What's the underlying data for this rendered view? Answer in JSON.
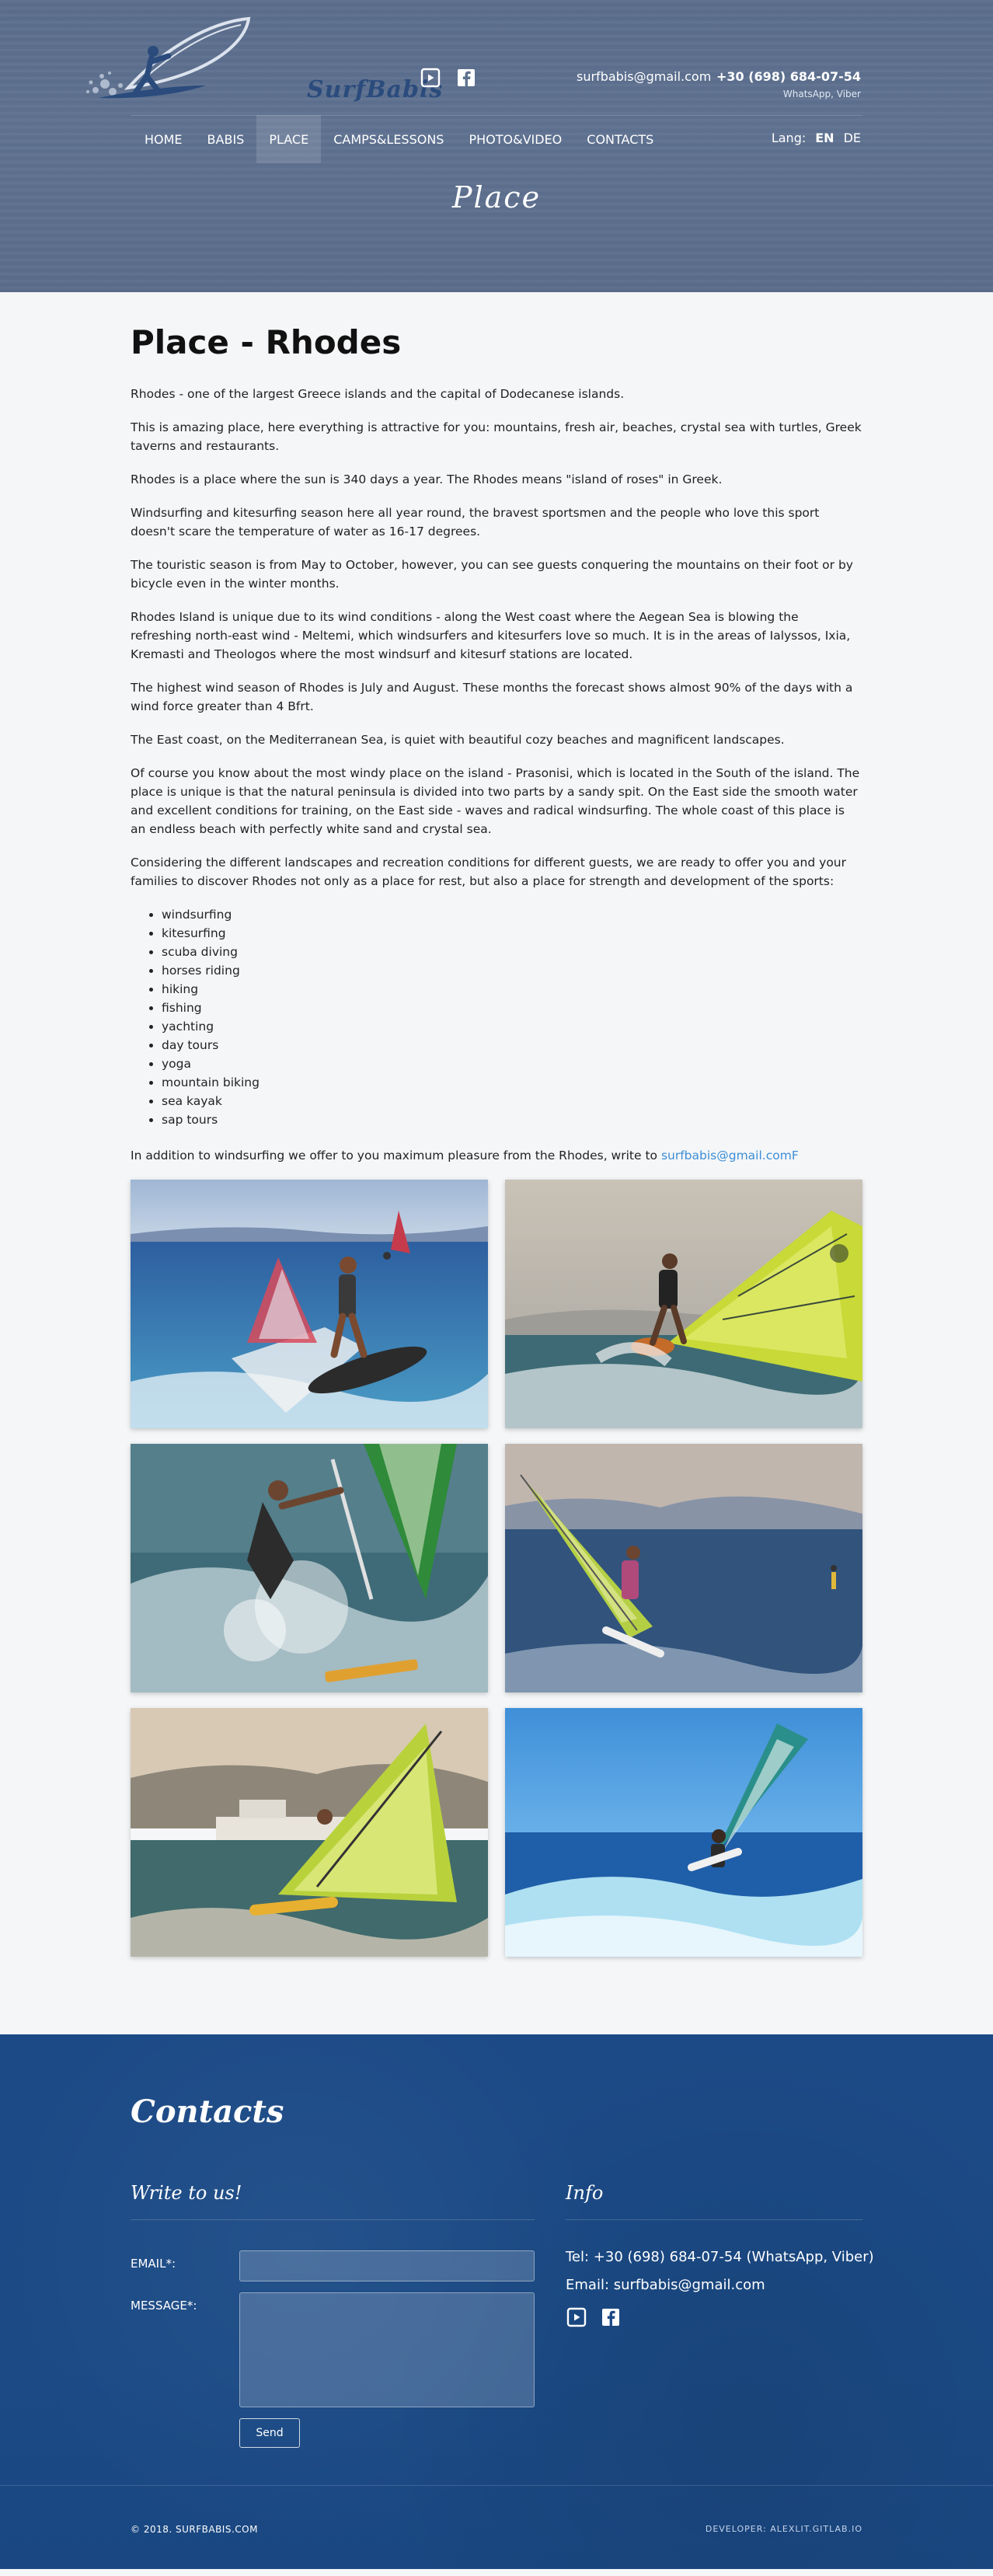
{
  "header": {
    "logo_text": "SurfBabis",
    "email": "surfbabis@gmail.com",
    "phone": "+30 (698) 684-07-54",
    "phone_note": "WhatsApp, Viber",
    "social_icons": [
      "youtube-icon",
      "facebook-icon"
    ],
    "nav": [
      {
        "label": "HOME",
        "active": false
      },
      {
        "label": "BABIS",
        "active": false
      },
      {
        "label": "PLACE",
        "active": true
      },
      {
        "label": "CAMPS&LESSONS",
        "active": false
      },
      {
        "label": "PHOTO&VIDEO",
        "active": false
      },
      {
        "label": "CONTACTS",
        "active": false
      }
    ],
    "lang_label": "Lang:",
    "lang_current": "EN",
    "lang_other": "DE",
    "hero_title": "Place"
  },
  "main": {
    "title": "Place - Rhodes",
    "paragraphs": [
      "Rhodes - one of the largest Greece islands and the capital of Dodecanese islands.",
      "This is amazing place, here everything is attractive for you: mountains, fresh air, beaches, crystal sea with turtles, Greek taverns and restaurants.",
      "Rhodes is a place where the sun is 340 days a year. The Rhodes means \"island of roses\" in Greek.",
      "Windsurfing and kitesurfing season here all year round, the bravest sportsmen and the people who love this sport doesn't scare the temperature of water as 16-17 degrees.",
      "The touristic season is from May to October, however, you can see guests conquering the mountains on their foot or by bicycle even in the winter months.",
      "Rhodes Island is unique due to its wind conditions - along the West coast where the Aegean Sea is blowing the refreshing north-east wind - Meltemi, which windsurfers and kitesurfers love so much. It is in the areas of Ialyssos, Ixia, Kremasti and Theologos where the most windsurf and kitesurf stations are located.",
      "The highest wind season of Rhodes is July and August. These months the forecast shows almost 90% of the days with a wind force greater than 4 Bfrt.",
      "The East coast, on the Mediterranean Sea, is quiet with beautiful cozy beaches and magnificent landscapes.",
      "Of course you know about the most windy place on the island - Prasonisi, which is located in the South of the island. The place is unique is that the natural peninsula is divided into two parts by a sandy spit. On the East side the smooth water and excellent conditions for training, on the East side - waves and radical windsurfing. The whole coast of this place is an endless beach with perfectly white sand and crystal sea.",
      "Considering the different landscapes and recreation conditions for different guests, we are ready to offer you and your families to discover Rhodes not only as a place for rest, but also a place for strength and development of the sports:"
    ],
    "sports": [
      "windsurfing",
      "kitesurfing",
      "scuba diving",
      "horses riding",
      "hiking",
      "fishing",
      "yachting",
      "day tours",
      "yoga",
      "mountain biking",
      "sea kayak",
      "sap tours"
    ],
    "write_text": "In addition to windsurfing we offer to you maximum pleasure from the Rhodes, write to ",
    "write_link": "surfbabis@gmail.comF"
  },
  "footer": {
    "title": "Contacts",
    "write_title": "Write to us!",
    "info_title": "Info",
    "email_label": "EMAIL*:",
    "message_label": "MESSAGE*:",
    "send_label": "Send",
    "tel": "Tel: +30 (698) 684-07-54 (WhatsApp, Viber)",
    "email": "Email: surfbabis@gmail.com",
    "copyright": "© 2018. SURFBABIS.COM",
    "developer": "DEVELOPER: ALEXLIT.GITLAB.IO"
  }
}
